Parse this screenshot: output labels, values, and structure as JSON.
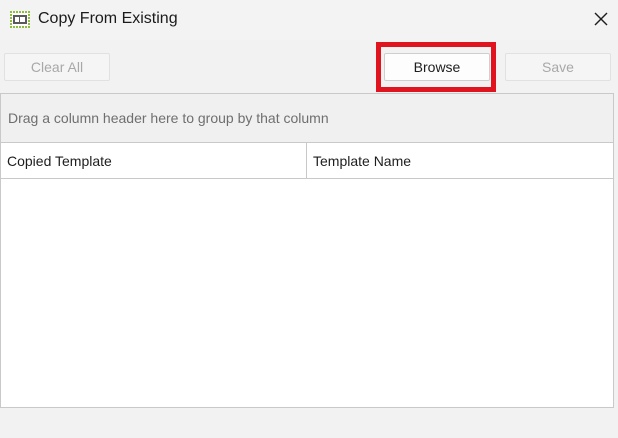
{
  "window": {
    "title": "Copy From Existing",
    "app_icon": "pm-grid-icon",
    "close_icon": "close-icon"
  },
  "toolbar": {
    "clear_all_label": "Clear All",
    "browse_label": "Browse",
    "save_label": "Save",
    "highlight_color": "#e0141e"
  },
  "grid": {
    "group_panel_text": "Drag a column header here to group by that column",
    "columns": [
      "Copied Template",
      "Template Name"
    ],
    "rows": []
  },
  "colors": {
    "window_bg": "#f2f2f2",
    "disabled_text": "#a8a8a8",
    "icon_green": "#8bbf3c"
  }
}
